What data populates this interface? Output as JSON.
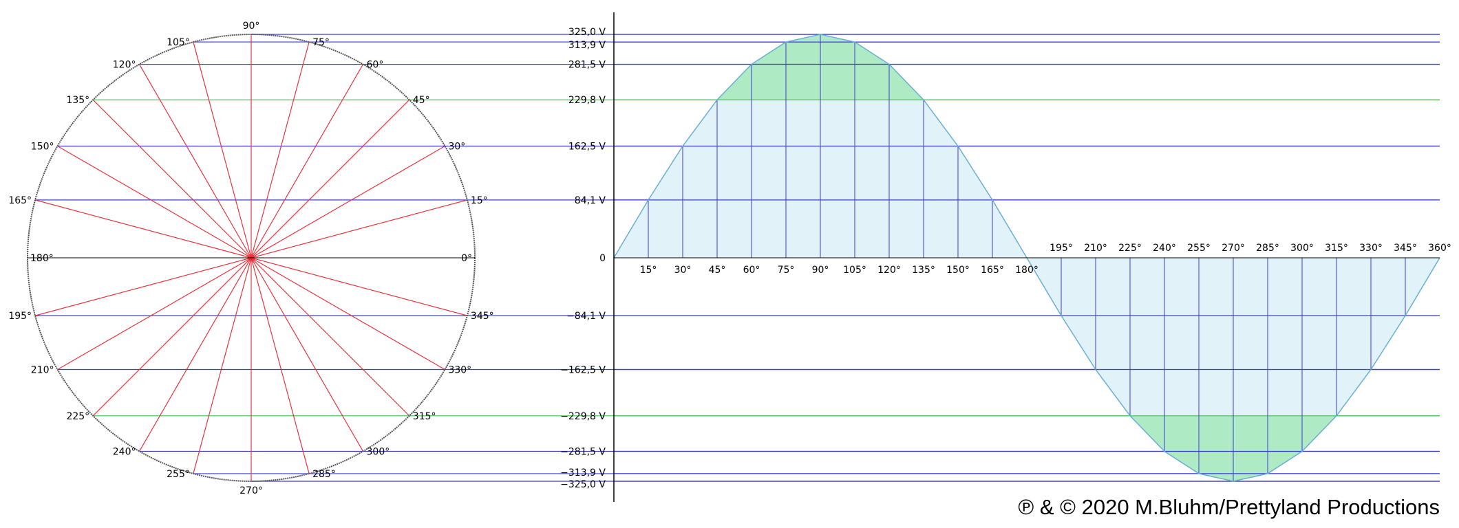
{
  "copyright": "℗ & © 2020 M.Bluhm/Prettyland Productions",
  "colors": {
    "radius": "#e8323c",
    "blue_line": "#3b3bd8",
    "green_line": "#3fbf4c",
    "axis": "#000000",
    "circle": "#555555",
    "fill_light": "#e1f2f8",
    "fill_green": "#aeebc4",
    "curve": "#6aaed6"
  },
  "circle_labels": [
    "0°",
    "15°",
    "30°",
    "45°",
    "60°",
    "75°",
    "90°",
    "105°",
    "120°",
    "135°",
    "150°",
    "165°",
    "180°",
    "195°",
    "210°",
    "225°",
    "240°",
    "255°",
    "270°",
    "285°",
    "300°",
    "315°",
    "330°",
    "345°"
  ],
  "voltage_labels": [
    "325,0 V",
    "313,9 V",
    "281,5 V",
    "229,8 V",
    "162,5 V",
    "84,1 V",
    "0",
    "−84,1 V",
    "−162,5 V",
    "−229,8 V",
    "−281,5 V",
    "−313,9 V",
    "−325,0 V"
  ],
  "wave_angle_labels": [
    "15°",
    "30°",
    "45°",
    "60°",
    "75°",
    "90°",
    "105°",
    "120°",
    "135°",
    "150°",
    "165°",
    "180°",
    "195°",
    "210°",
    "225°",
    "240°",
    "255°",
    "270°",
    "285°",
    "300°",
    "315°",
    "330°",
    "345°",
    "360°"
  ],
  "chart_data": {
    "type": "line",
    "series": [
      {
        "x": [
          0,
          15,
          30,
          45,
          60,
          75,
          90,
          105,
          120,
          135,
          150,
          165,
          180,
          195,
          210,
          225,
          240,
          255,
          270,
          285,
          300,
          315,
          330,
          345,
          360
        ],
        "values": [
          0,
          84.1,
          162.5,
          229.8,
          281.5,
          313.9,
          325.0,
          313.9,
          281.5,
          229.8,
          162.5,
          84.1,
          0,
          -84.1,
          -162.5,
          -229.8,
          -281.5,
          -313.9,
          -325.0,
          -313.9,
          -281.5,
          -229.8,
          -162.5,
          -84.1,
          0
        ]
      }
    ],
    "ylim": [
      -325.0,
      325.0
    ],
    "xlim": [
      0,
      360
    ]
  }
}
